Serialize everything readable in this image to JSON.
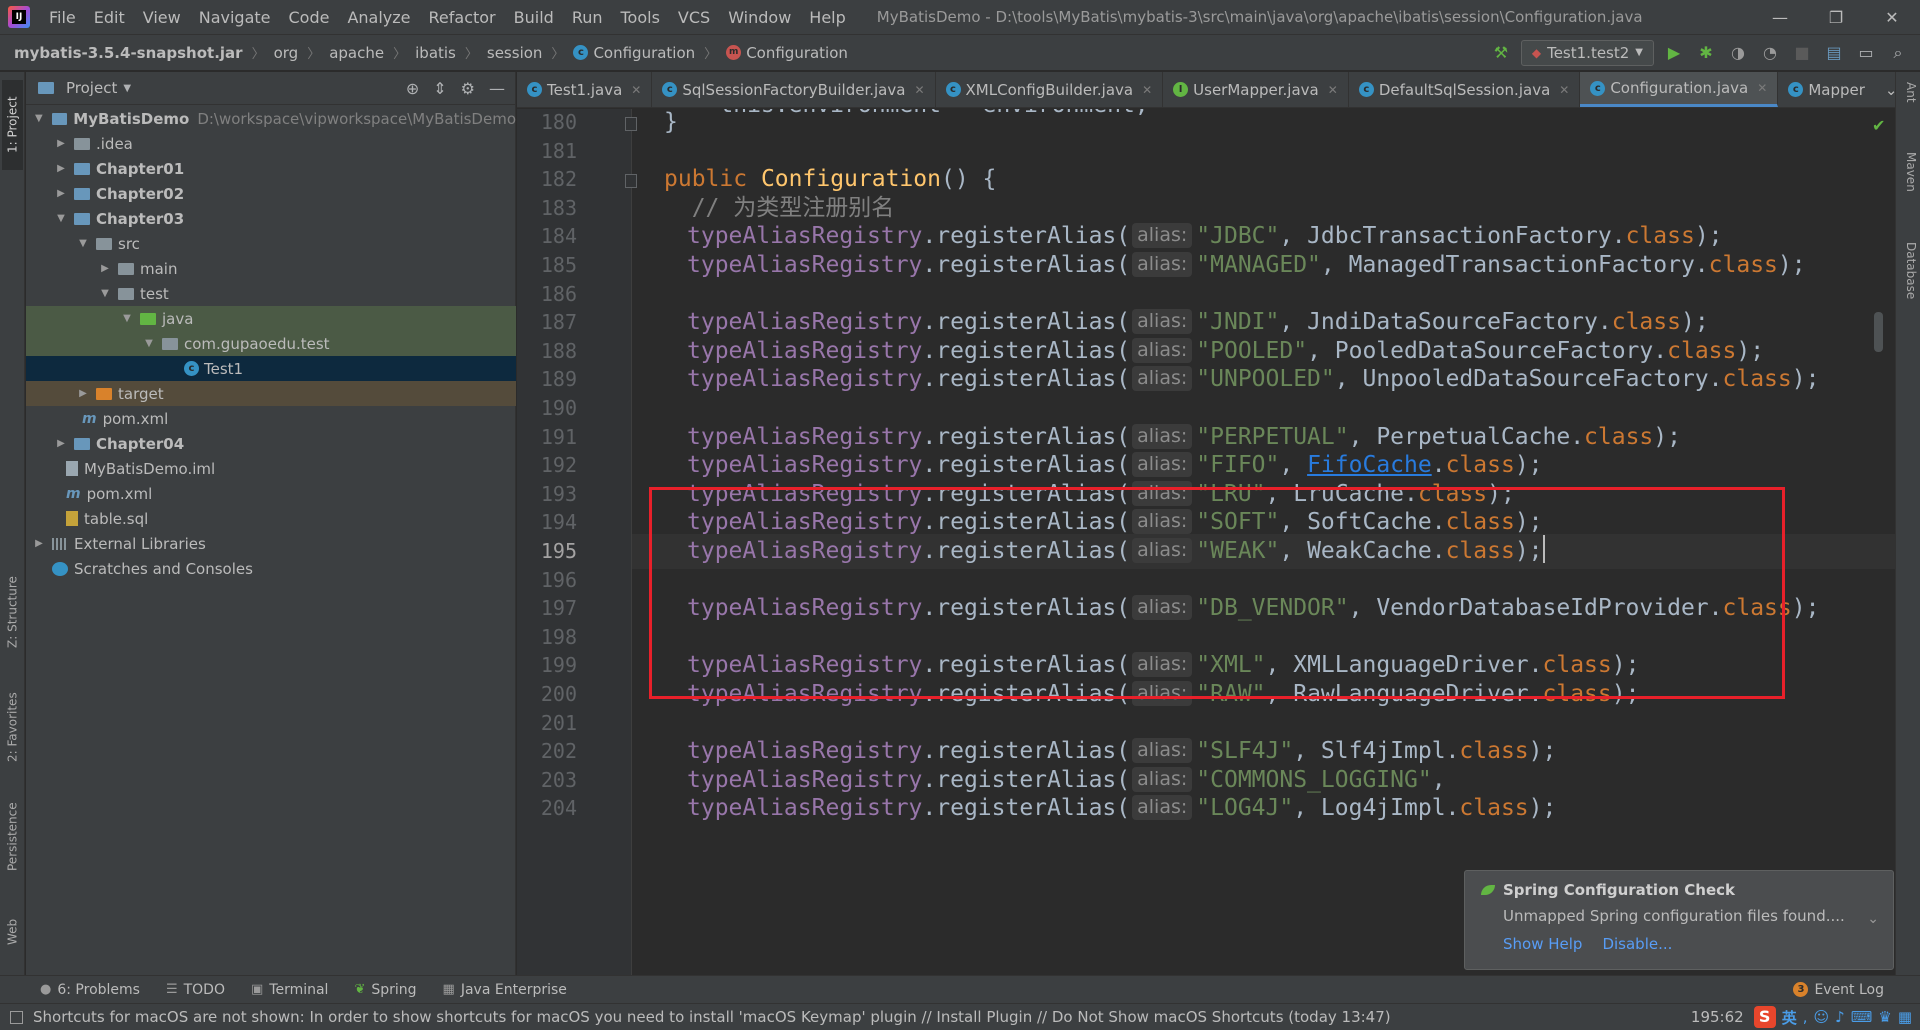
{
  "app": {
    "logo_text": "IJ",
    "window_title": "MyBatisDemo - D:\\tools\\MyBatis\\mybatis-3\\src\\main\\java\\org\\apache\\ibatis\\session\\Configuration.java",
    "menu": [
      "File",
      "Edit",
      "View",
      "Navigate",
      "Code",
      "Analyze",
      "Refactor",
      "Build",
      "Run",
      "Tools",
      "VCS",
      "Window",
      "Help"
    ],
    "window_controls": {
      "minimize": "—",
      "restore": "❐",
      "close": "✕"
    }
  },
  "navbar": {
    "breadcrumb": [
      "mybatis-3.5.4-snapshot.jar",
      "org",
      "apache",
      "ibatis",
      "session",
      "Configuration",
      "Configuration"
    ],
    "run_config": "Test1.test2"
  },
  "left_stripe": [
    "1: Project",
    "Z: Structure",
    "2: Favorites",
    "Persistence",
    "Web"
  ],
  "right_stripe": [
    "Ant",
    "Maven",
    "Database"
  ],
  "project_panel": {
    "title": "Project",
    "tree": [
      {
        "label": "MyBatisDemo",
        "path": "D:\\workspace\\vipworkspace\\MyBatisDemo"
      },
      {
        "label": ".idea"
      },
      {
        "label": "Chapter01"
      },
      {
        "label": "Chapter02"
      },
      {
        "label": "Chapter03"
      },
      {
        "label": "src"
      },
      {
        "label": "main"
      },
      {
        "label": "test"
      },
      {
        "label": "java"
      },
      {
        "label": "com.gupaoedu.test"
      },
      {
        "label": "Test1"
      },
      {
        "label": "target"
      },
      {
        "label": "pom.xml"
      },
      {
        "label": "Chapter04"
      },
      {
        "label": "MyBatisDemo.iml"
      },
      {
        "label": "pom.xml"
      },
      {
        "label": "table.sql"
      },
      {
        "label": "External Libraries"
      },
      {
        "label": "Scratches and Consoles"
      }
    ]
  },
  "editor": {
    "tabs": [
      {
        "label": "Test1.java",
        "icon": "c"
      },
      {
        "label": "SqlSessionFactoryBuilder.java",
        "icon": "c"
      },
      {
        "label": "XMLConfigBuilder.java",
        "icon": "c"
      },
      {
        "label": "UserMapper.java",
        "icon": "i"
      },
      {
        "label": "DefaultSqlSession.java",
        "icon": "c"
      },
      {
        "label": "Configuration.java",
        "icon": "c",
        "active": true
      },
      {
        "label": "Mapper",
        "icon": "c"
      }
    ],
    "line_numbers": [
      "180",
      "181",
      "182",
      "183",
      "184",
      "185",
      "186",
      "187",
      "188",
      "189",
      "190",
      "191",
      "192",
      "193",
      "194",
      "195",
      "196",
      "197",
      "198",
      "199",
      "200",
      "201",
      "202",
      "203",
      "204"
    ],
    "current_line": "195",
    "hint_label": "alias:",
    "code": {
      "l179_partial": "    this.environment = environment;",
      "l180": "}",
      "l182_kw": "public",
      "l182_fn": "Configuration",
      "l182_rest": "() {",
      "l183": "  // 为类型注册别名",
      "receiver": "typeAliasRegistry",
      "method": ".registerAlias(",
      "class_kw": "class",
      "aliases": [
        {
          "line": "184",
          "alias": "\"JDBC\"",
          "cls": "JdbcTransactionFactory"
        },
        {
          "line": "185",
          "alias": "\"MANAGED\"",
          "cls": "ManagedTransactionFactory"
        },
        {
          "line": "187",
          "alias": "\"JNDI\"",
          "cls": "JndiDataSourceFactory"
        },
        {
          "line": "188",
          "alias": "\"POOLED\"",
          "cls": "PooledDataSourceFactory"
        },
        {
          "line": "189",
          "alias": "\"UNPOOLED\"",
          "cls": "UnpooledDataSourceFactory"
        },
        {
          "line": "191",
          "alias": "\"PERPETUAL\"",
          "cls": "PerpetualCache"
        },
        {
          "line": "192",
          "alias": "\"FIFO\"",
          "cls": "FifoCache"
        },
        {
          "line": "193",
          "alias": "\"LRU\"",
          "cls": "LruCache"
        },
        {
          "line": "194",
          "alias": "\"SOFT\"",
          "cls": "SoftCache"
        },
        {
          "line": "195",
          "alias": "\"WEAK\"",
          "cls": "WeakCache"
        },
        {
          "line": "197",
          "alias": "\"DB_VENDOR\"",
          "cls": "VendorDatabaseIdProvider"
        },
        {
          "line": "199",
          "alias": "\"XML\"",
          "cls": "XMLLanguageDriver"
        },
        {
          "line": "200",
          "alias": "\"RAW\"",
          "cls": "RawLanguageDriver"
        },
        {
          "line": "202",
          "alias": "\"SLF4J\"",
          "cls": "Slf4jImpl"
        },
        {
          "line": "203",
          "alias": "\"COMMONS_LOGGING\"",
          "cls": ""
        },
        {
          "line": "204",
          "alias": "\"LOG4J\"",
          "cls": "Log4jImpl"
        }
      ]
    }
  },
  "notification": {
    "title": "Spring Configuration Check",
    "body": "Unmapped Spring configuration files found....",
    "actions": [
      "Show Help",
      "Disable..."
    ]
  },
  "bottom_tools": {
    "problems": "6: Problems",
    "todo": "TODO",
    "terminal": "Terminal",
    "spring": "Spring",
    "java_enterprise": "Java Enterprise",
    "event_log": "Event Log",
    "event_count": "3"
  },
  "status": {
    "text": "Shortcuts for macOS are not shown: In order to show shortcuts for macOS you need to install 'macOS Keymap' plugin // Install Plugin // Do Not Show macOS Shortcuts (today 13:47)",
    "position": "195:62",
    "ime_label": "英"
  },
  "colors": {
    "background": "#2b2b2b",
    "panel": "#3c3f41",
    "keyword": "#cc7832",
    "string": "#6a8759",
    "function": "#ffc66d",
    "field": "#9876aa",
    "highlight_box": "#e8202a",
    "link": "#287bde"
  }
}
